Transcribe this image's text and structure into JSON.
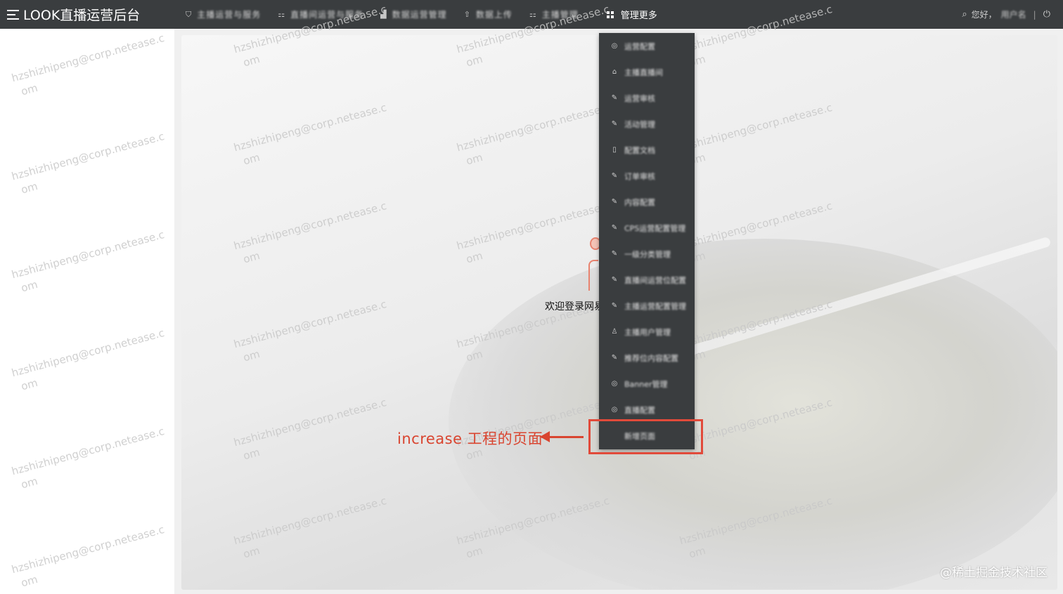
{
  "app": {
    "title": "LOOK直播运营后台"
  },
  "nav": {
    "items": [
      {
        "label": "主播运营与服务",
        "icon": "shield-check-icon"
      },
      {
        "label": "直播间运营与服务",
        "icon": "apps-icon"
      },
      {
        "label": "数据运营管理",
        "icon": "bar-chart-icon"
      },
      {
        "label": "数据上传",
        "icon": "upload-icon"
      },
      {
        "label": "主播管理",
        "icon": "apps-icon"
      }
    ],
    "active": {
      "label": "管理更多",
      "icon": "grid-icon"
    }
  },
  "user": {
    "greeting": "您好，",
    "name": "用户名",
    "logout_icon": "logout-icon"
  },
  "dropdown": {
    "items": [
      {
        "label": "运营配置",
        "icon": "target-icon"
      },
      {
        "label": "主播直播间",
        "icon": "home-icon"
      },
      {
        "label": "运营审核",
        "icon": "edit-icon"
      },
      {
        "label": "活动管理",
        "icon": "edit-icon"
      },
      {
        "label": "配置文档",
        "icon": "document-icon"
      },
      {
        "label": "订单审核",
        "icon": "edit-icon"
      },
      {
        "label": "内容配置",
        "icon": "edit-icon"
      },
      {
        "label": "CPS运营配置管理",
        "icon": "edit-icon"
      },
      {
        "label": "一级分类管理",
        "icon": "edit-icon"
      },
      {
        "label": "直播间运营位配置",
        "icon": "edit-icon"
      },
      {
        "label": "主播运营配置管理",
        "icon": "edit-icon"
      },
      {
        "label": "主播用户管理",
        "icon": "user-icon"
      },
      {
        "label": "推荐位内容配置",
        "icon": "edit-icon"
      },
      {
        "label": "Banner管理",
        "icon": "target-icon"
      },
      {
        "label": "直播配置",
        "icon": "target-icon"
      },
      {
        "label": "新增页面",
        "icon": ""
      }
    ]
  },
  "main": {
    "welcome": "欢迎登录网易"
  },
  "watermark": {
    "line1": "hzshizhipeng@corp.netease.c",
    "line2": "om"
  },
  "annotation": {
    "text": "increase 工程的页面",
    "color": "#d94530"
  },
  "credit": {
    "text": "@稀土掘金技术社区"
  },
  "colors": {
    "topbar": "#3a3d3f",
    "dropdown": "#3a3d3f",
    "highlight": "#e14a3a"
  }
}
